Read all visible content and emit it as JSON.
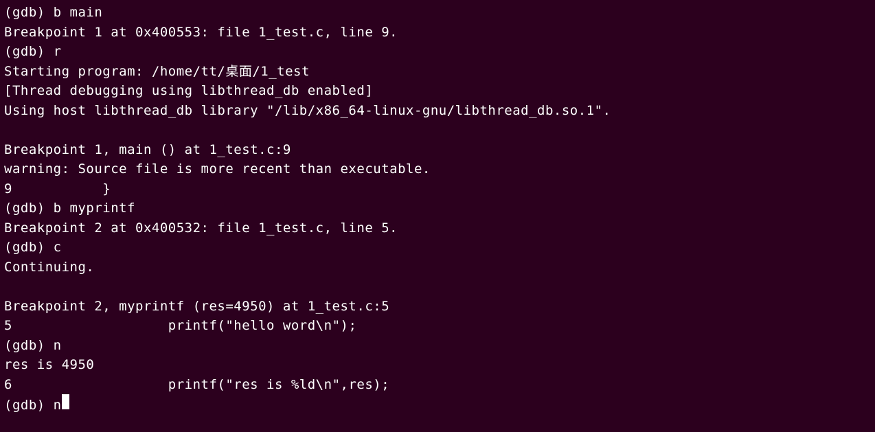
{
  "terminal": {
    "lines": [
      {
        "prompt": "(gdb) ",
        "input": "b main",
        "interactable": false
      },
      {
        "output": "Breakpoint 1 at 0x400553: file 1_test.c, line 9."
      },
      {
        "prompt": "(gdb) ",
        "input": "r",
        "interactable": false
      },
      {
        "output": "Starting program: /home/tt/桌面/1_test "
      },
      {
        "output": "[Thread debugging using libthread_db enabled]"
      },
      {
        "output": "Using host libthread_db library \"/lib/x86_64-linux-gnu/libthread_db.so.1\"."
      },
      {
        "output": ""
      },
      {
        "output": "Breakpoint 1, main () at 1_test.c:9"
      },
      {
        "output": "warning: Source file is more recent than executable."
      },
      {
        "output": "9\t    }"
      },
      {
        "prompt": "(gdb) ",
        "input": "b myprintf",
        "interactable": false
      },
      {
        "output": "Breakpoint 2 at 0x400532: file 1_test.c, line 5."
      },
      {
        "prompt": "(gdb) ",
        "input": "c",
        "interactable": false
      },
      {
        "output": "Continuing."
      },
      {
        "output": ""
      },
      {
        "output": "Breakpoint 2, myprintf (res=4950) at 1_test.c:5"
      },
      {
        "output": "5\t            printf(\"hello word\\n\");"
      },
      {
        "prompt": "(gdb) ",
        "input": "n",
        "interactable": false
      },
      {
        "output": "res is 4950"
      },
      {
        "output": "6\t            printf(\"res is %ld\\n\",res);"
      },
      {
        "prompt": "(gdb) ",
        "input": "n",
        "interactable": true,
        "cursor": true
      }
    ]
  }
}
